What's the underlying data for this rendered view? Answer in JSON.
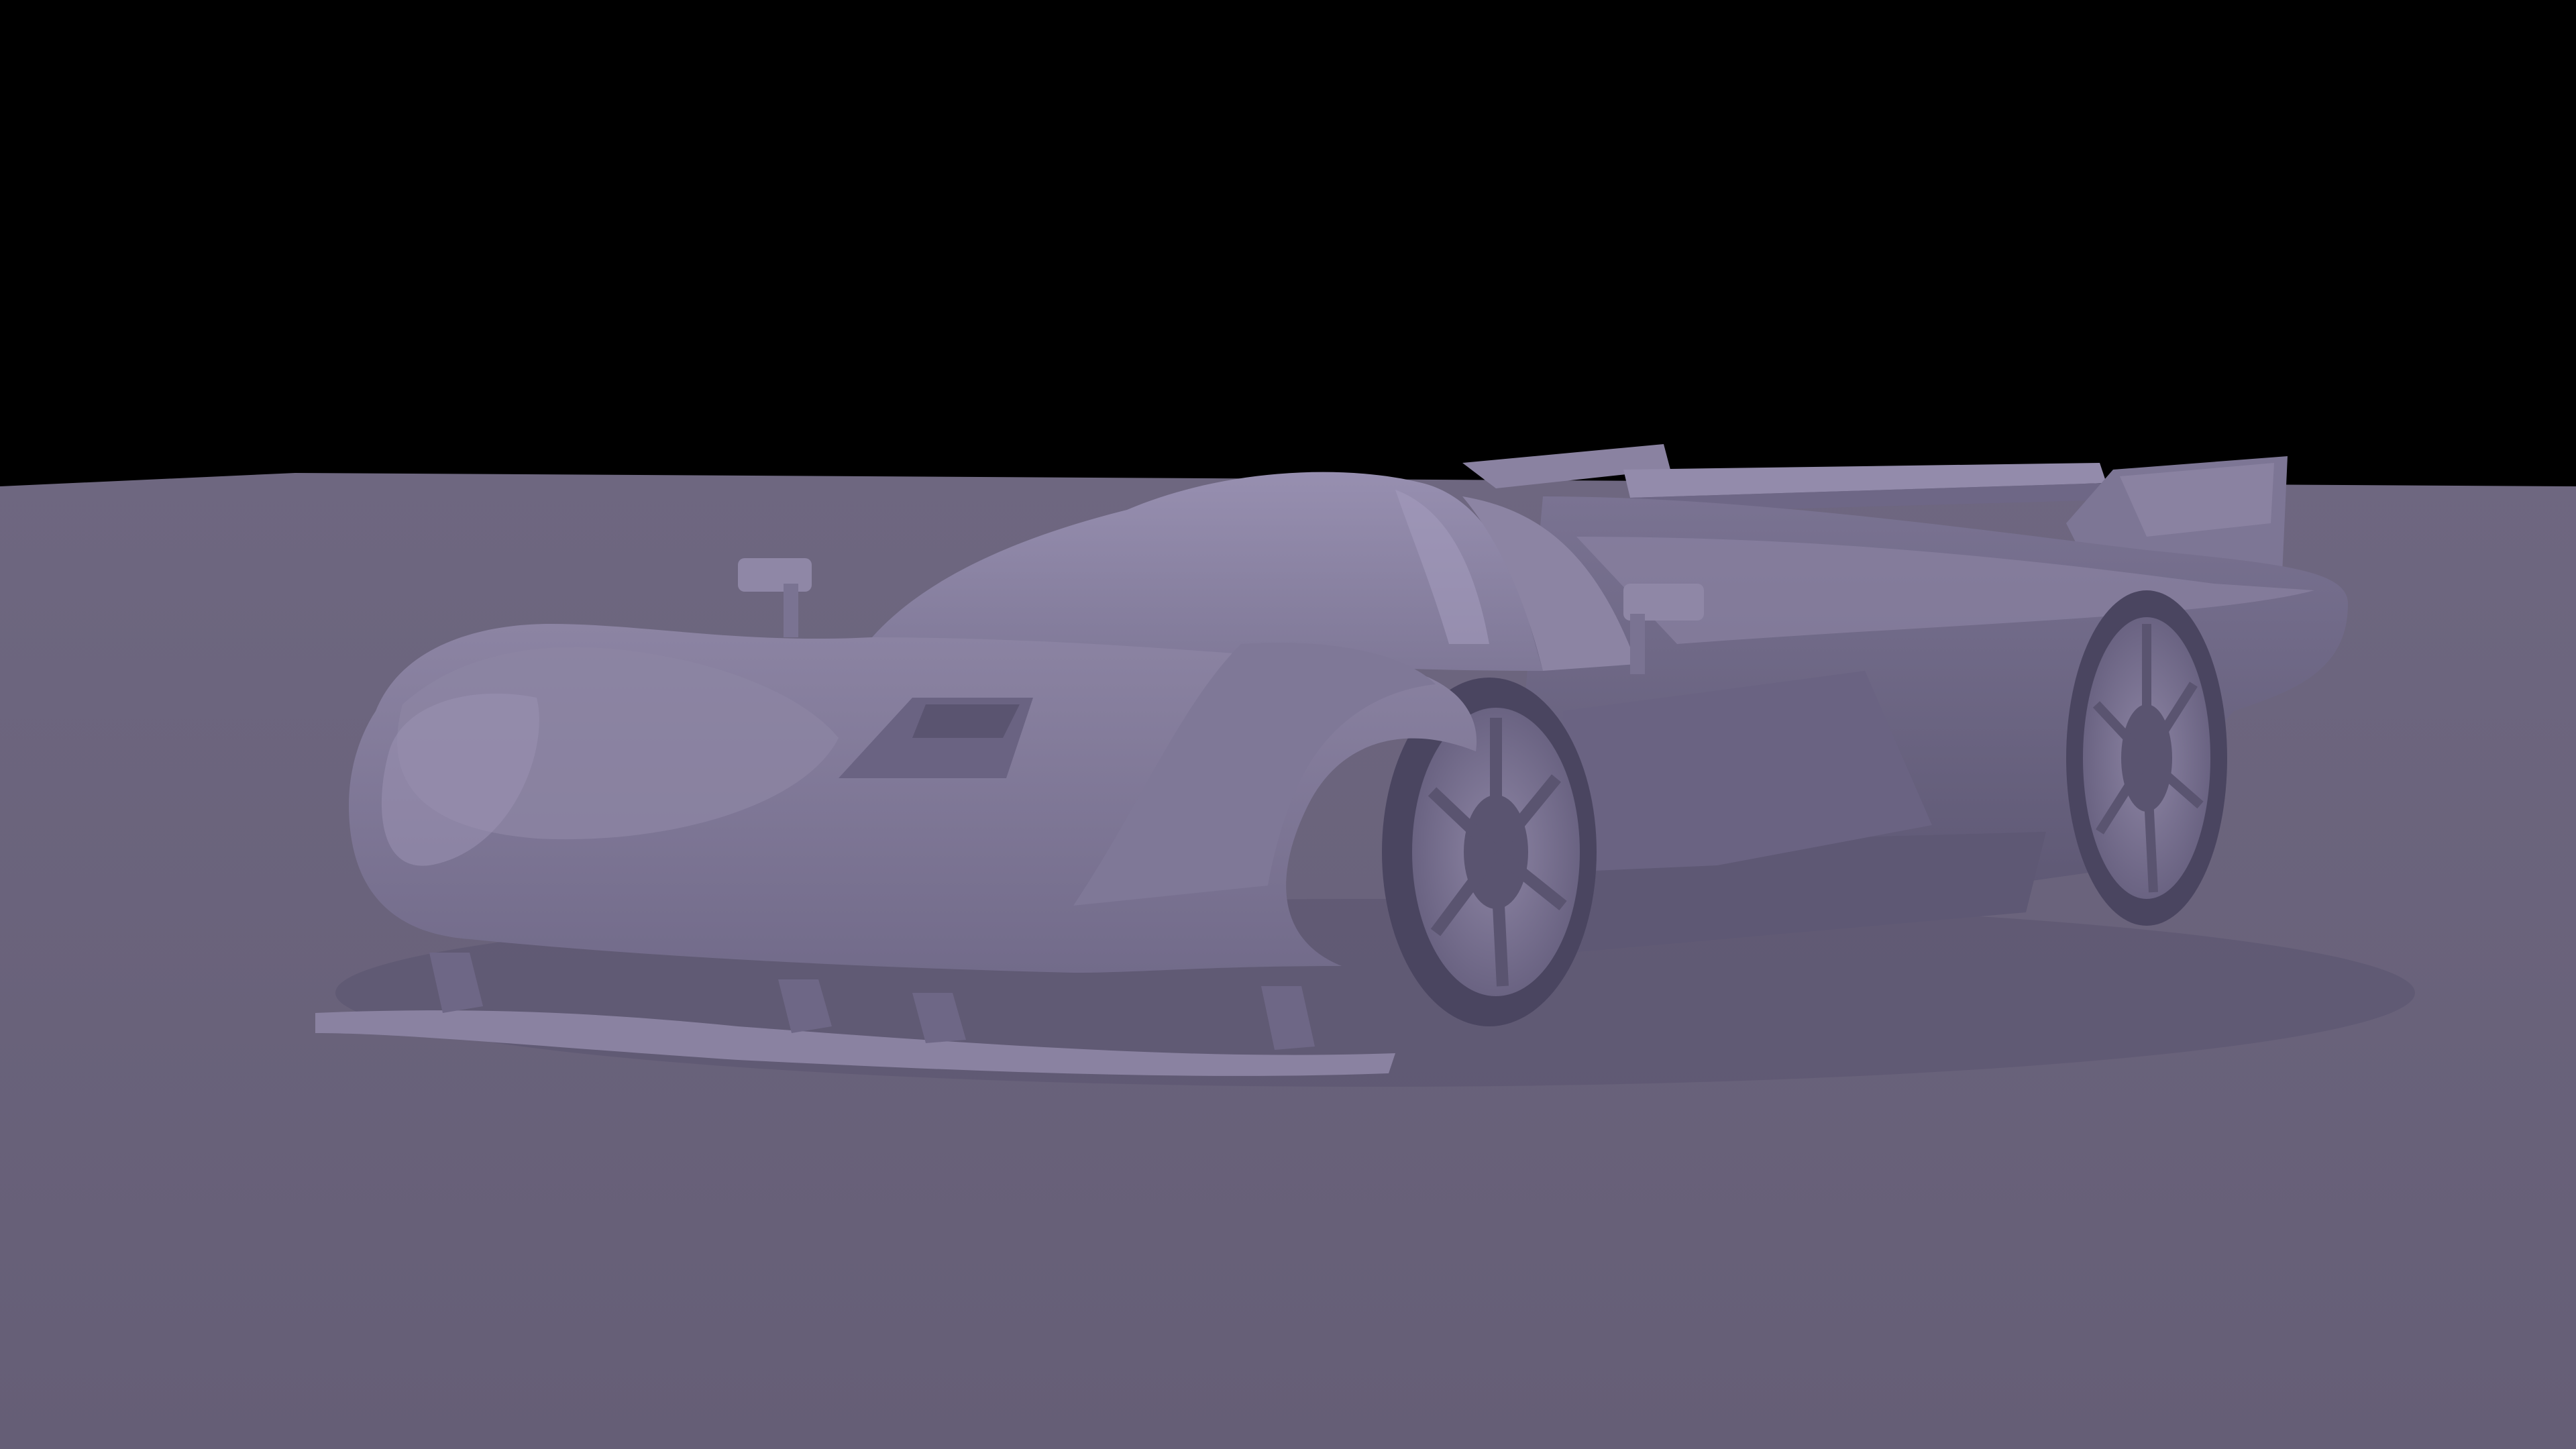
{
  "scene": {
    "subject": "race-car-clay-render",
    "colors": {
      "background": "#000000",
      "ground": "#6a6379",
      "body_light": "#8f87a6",
      "body_mid": "#7a7392",
      "body_dark": "#5a5470",
      "tire": "#4a4560",
      "highlight": "#a39bbd"
    }
  }
}
